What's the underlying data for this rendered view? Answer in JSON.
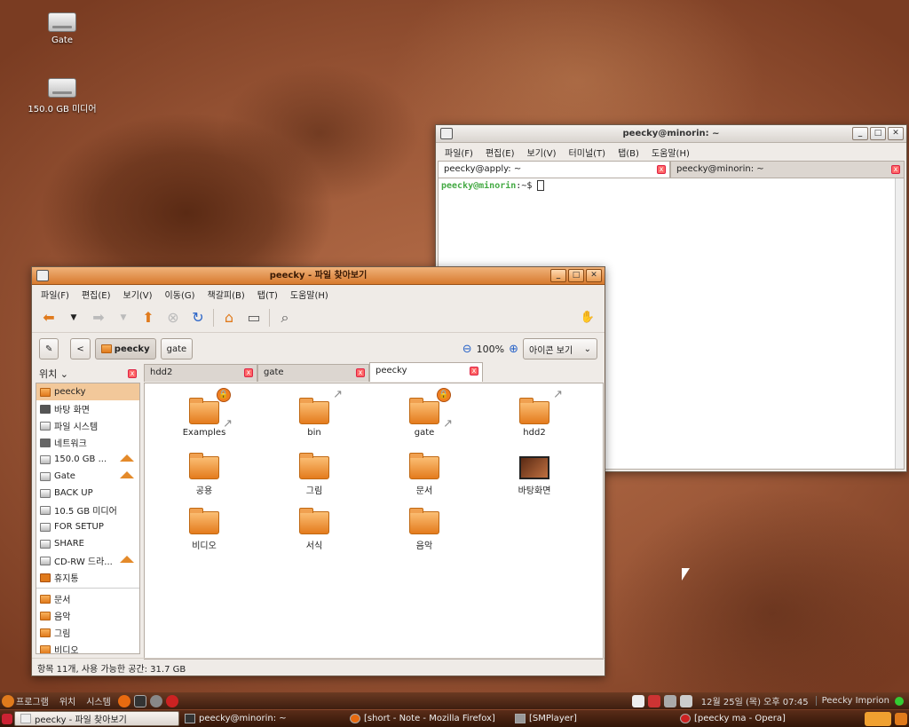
{
  "desktop": {
    "icons": [
      {
        "label": "Gate",
        "icon": "drive-icon"
      },
      {
        "label": "150.0 GB 미디어",
        "icon": "drive-icon"
      }
    ]
  },
  "terminal": {
    "title": "peecky@minorin: ~",
    "menu": [
      "파일(F)",
      "편집(E)",
      "보기(V)",
      "터미널(T)",
      "탭(B)",
      "도움말(H)"
    ],
    "tabs": [
      "peecky@apply: ~",
      "peecky@minorin: ~"
    ],
    "prompt_user": "peecky@minorin",
    "prompt_rest": ":~$"
  },
  "fm": {
    "title": "peecky - 파일 찾아보기",
    "menu": [
      "파일(F)",
      "편집(E)",
      "보기(V)",
      "이동(G)",
      "책갈피(B)",
      "탭(T)",
      "도움말(H)"
    ],
    "location": {
      "back": "<",
      "crumbs": [
        "peecky",
        "gate"
      ]
    },
    "zoom": "100%",
    "view_mode": "아이콘 보기",
    "sidebar_title": "위치",
    "places": [
      {
        "label": "peecky",
        "icon": "home-folder-icon",
        "selected": true
      },
      {
        "label": "바탕 화면",
        "icon": "desktop-icon"
      },
      {
        "label": "파일 시스템",
        "icon": "filesystem-icon"
      },
      {
        "label": "네트워크",
        "icon": "network-icon"
      },
      {
        "label": "150.0 GB ...",
        "icon": "drive-icon",
        "eject": true
      },
      {
        "label": "Gate",
        "icon": "drive-icon",
        "eject": true
      },
      {
        "label": "BACK UP",
        "icon": "drive-icon"
      },
      {
        "label": "10.5 GB 미디어",
        "icon": "drive-icon"
      },
      {
        "label": "FOR SETUP",
        "icon": "drive-icon"
      },
      {
        "label": "SHARE",
        "icon": "drive-icon"
      },
      {
        "label": "CD-RW 드라...",
        "icon": "cdrom-icon",
        "eject": true
      },
      {
        "label": "휴지통",
        "icon": "trash-icon"
      }
    ],
    "bookmarks": [
      "문서",
      "음악",
      "그림",
      "비디오"
    ],
    "tabs": [
      "hdd2",
      "gate",
      "peecky"
    ],
    "files": [
      {
        "name": "Examples",
        "emblem": "lock"
      },
      {
        "name": "bin",
        "emblem": "link"
      },
      {
        "name": "gate",
        "emblem": "lock"
      },
      {
        "name": "hdd2",
        "emblem": "link"
      },
      {
        "name": "공용"
      },
      {
        "name": "그림"
      },
      {
        "name": "문서"
      },
      {
        "name": "바탕화면",
        "type": "wallpaper"
      },
      {
        "name": "비디오"
      },
      {
        "name": "서식"
      },
      {
        "name": "음악"
      }
    ],
    "status": "항목 11개, 사용 가능한 공간: 31.7 GB"
  },
  "top_panel": {
    "menus": [
      "프로그램",
      "위치",
      "시스템"
    ],
    "clock": "12월 25일 (목) 오후 07:45",
    "user": "Peecky Imprion"
  },
  "taskbar": {
    "tasks": [
      {
        "label": "peecky - 파일 찾아보기",
        "active": true
      },
      {
        "label": "peecky@minorin: ~"
      },
      {
        "label": "[short - Note - Mozilla Firefox]"
      },
      {
        "label": "[SMPlayer]"
      },
      {
        "label": "[peecky ma - Opera]"
      }
    ]
  }
}
